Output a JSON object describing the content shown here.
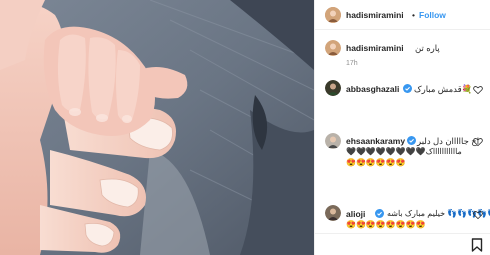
{
  "post": {
    "username": "hadismiramini",
    "follow_label": "Follow",
    "dot": "•",
    "caption_text": "پاره تن",
    "caption_time": "17h"
  },
  "comments": [
    {
      "username": "abbasghazali",
      "text": "قدمش مبارک💐"
    },
    {
      "username": "ehsaankaramy",
      "text_line1": "اخ جااااان دل دلبر",
      "text_line2": "🖤🖤🖤🖤🖤🖤🖤🖤ماااااااااااک",
      "text_line3": "😍😍😍😍😍😍"
    },
    {
      "username": "alioji",
      "text_line1": "خیلیم مبارک باشه 👣👣👣👣👣👣",
      "text_line2": "😍😍😍😍😍😍😍😍"
    }
  ],
  "colors": {
    "link": "#3897f0",
    "verified": "#3897f0",
    "muted": "#8e8e8e"
  },
  "icons": [
    "heart-icon",
    "verified-badge-icon",
    "bookmark-icon"
  ]
}
